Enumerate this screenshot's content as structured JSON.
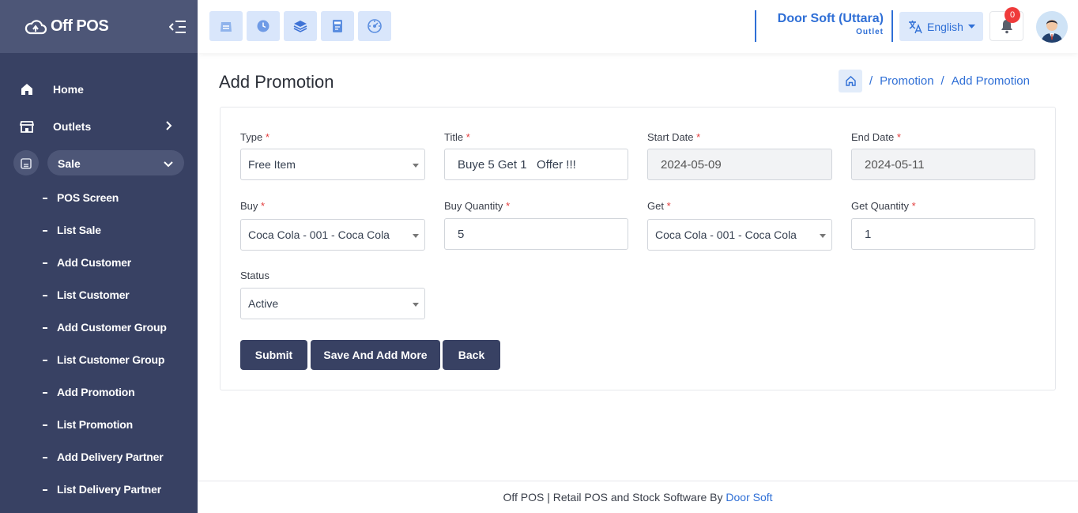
{
  "brand": {
    "name": "Off POS"
  },
  "sidebar": {
    "items": [
      {
        "label": "Home",
        "icon": "home-icon"
      },
      {
        "label": "Outlets",
        "icon": "store-icon"
      },
      {
        "label": "Sale",
        "icon": "pos-icon",
        "expanded": true
      }
    ],
    "sub_items": [
      "POS Screen",
      "List Sale",
      "Add Customer",
      "List Customer",
      "Add Customer Group",
      "List Customer Group",
      "Add Promotion",
      "List Promotion",
      "Add Delivery Partner",
      "List Delivery Partner"
    ]
  },
  "topbar": {
    "quick_icons": [
      "pos-register-icon",
      "clock-icon",
      "layers-icon",
      "calculator-icon",
      "dashboard-gauge-icon"
    ],
    "outlet_name": "Door Soft (Uttara)",
    "outlet_sub": "Outlet",
    "language": "English",
    "notification_count": "0"
  },
  "page": {
    "title": "Add Promotion",
    "breadcrumb": {
      "section": "Promotion",
      "current": "Add Promotion",
      "sep": "/"
    }
  },
  "form": {
    "type": {
      "label": "Type",
      "value": "Free Item"
    },
    "title": {
      "label": "Title",
      "value": "Buye 5 Get 1   Offer !!!"
    },
    "start_date": {
      "label": "Start Date",
      "value": "2024-05-09"
    },
    "end_date": {
      "label": "End Date",
      "value": "2024-05-11"
    },
    "buy": {
      "label": "Buy",
      "value": "Coca Cola - 001 - Coca Cola"
    },
    "buy_quantity": {
      "label": "Buy Quantity",
      "value": "5"
    },
    "get": {
      "label": "Get",
      "value": "Coca Cola - 001 - Coca Cola"
    },
    "get_quantity": {
      "label": "Get Quantity",
      "value": "1"
    },
    "status": {
      "label": "Status",
      "value": "Active"
    },
    "required_mark": "*"
  },
  "buttons": {
    "submit": "Submit",
    "save_add_more": "Save And Add More",
    "back": "Back"
  },
  "footer": {
    "text": "Off POS | Retail POS and Stock Software By ",
    "link": "Door Soft"
  },
  "colors": {
    "sidebar": "#384163",
    "accent": "#2f6fd6",
    "danger": "#e23b3b"
  }
}
